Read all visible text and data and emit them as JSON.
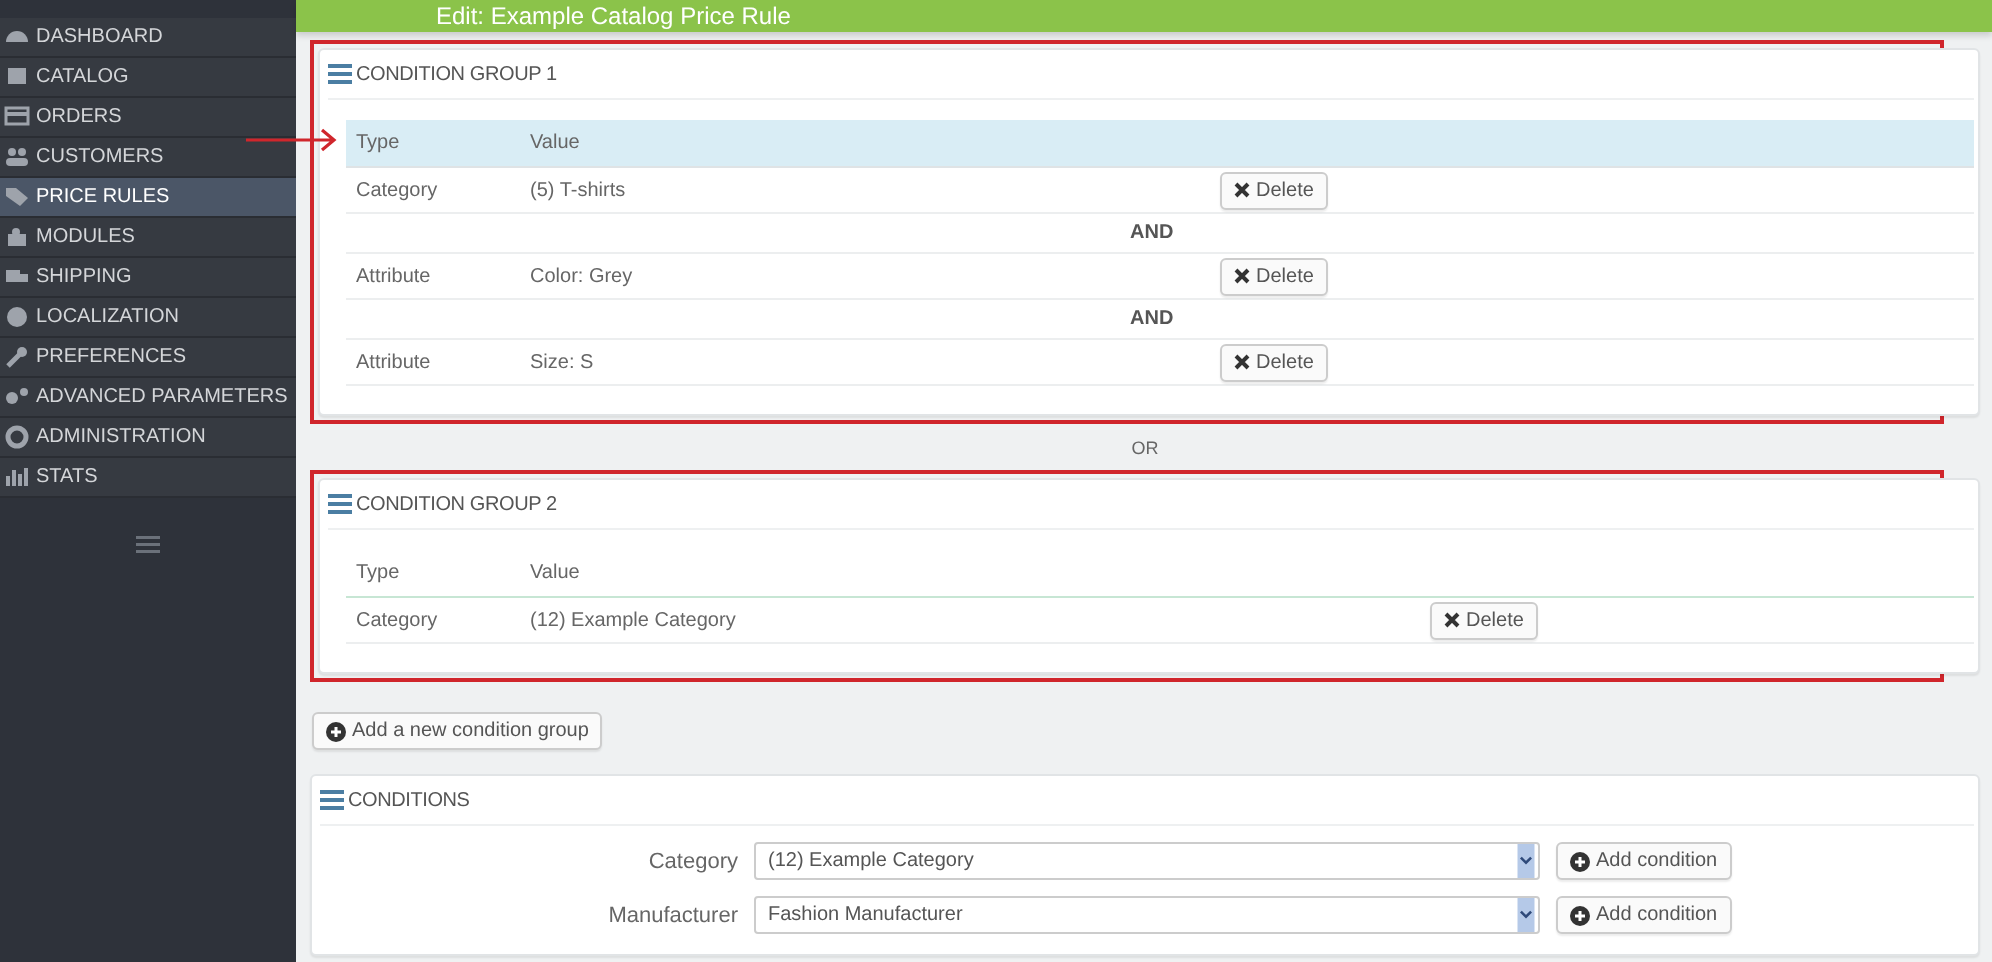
{
  "header": {
    "title": "Edit: Example Catalog Price Rule"
  },
  "sidebar": {
    "items": [
      {
        "label": "DASHBOARD",
        "selected": false
      },
      {
        "label": "CATALOG",
        "selected": false
      },
      {
        "label": "ORDERS",
        "selected": false
      },
      {
        "label": "CUSTOMERS",
        "selected": false
      },
      {
        "label": "PRICE RULES",
        "selected": true
      },
      {
        "label": "MODULES",
        "selected": false
      },
      {
        "label": "SHIPPING",
        "selected": false
      },
      {
        "label": "LOCALIZATION",
        "selected": false
      },
      {
        "label": "PREFERENCES",
        "selected": false
      },
      {
        "label": "ADVANCED PARAMETERS",
        "selected": false
      },
      {
        "label": "ADMINISTRATION",
        "selected": false
      },
      {
        "label": "STATS",
        "selected": false
      }
    ]
  },
  "condition_groups": [
    {
      "title": "CONDITION GROUP 1",
      "highlighted": true,
      "arrow": true,
      "header_highlighted": true,
      "columns": [
        "Type",
        "Value"
      ],
      "rows": [
        {
          "kind": "condition",
          "type": "Category",
          "value": "(5) T-shirts",
          "button": "Delete"
        },
        {
          "kind": "operator",
          "label": "AND"
        },
        {
          "kind": "condition",
          "type": "Attribute",
          "value": "Color: Grey",
          "button": "Delete"
        },
        {
          "kind": "operator",
          "label": "AND"
        },
        {
          "kind": "condition",
          "type": "Attribute",
          "value": "Size: S",
          "button": "Delete"
        }
      ]
    },
    {
      "title": "CONDITION GROUP 2",
      "highlighted": true,
      "arrow": false,
      "header_highlighted": false,
      "columns": [
        "Type",
        "Value"
      ],
      "rows": [
        {
          "kind": "condition",
          "type": "Category",
          "value": "(12) Example Category",
          "button": "Delete"
        }
      ]
    }
  ],
  "group_separator": "OR",
  "add_group_button": "Add a new condition group",
  "conditions": {
    "title": "CONDITIONS",
    "rows": [
      {
        "label": "Category",
        "value": "(12) Example Category",
        "button": "Add condition"
      },
      {
        "label": "Manufacturer",
        "value": "Fashion Manufacturer",
        "button": "Add condition"
      }
    ]
  }
}
